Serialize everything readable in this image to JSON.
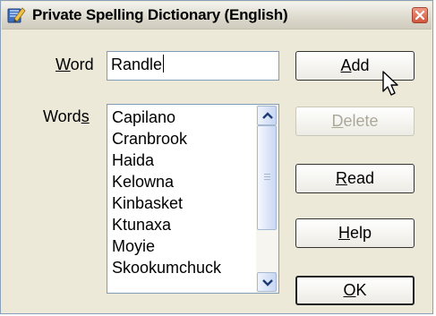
{
  "window": {
    "title": "Private Spelling Dictionary (English)"
  },
  "word_field": {
    "label_mnemonic": "W",
    "label_rest": "ord",
    "value": "Randle"
  },
  "words_list": {
    "label_prefix": "Word",
    "label_mnemonic": "s",
    "items": [
      "Capilano",
      "Cranbrook",
      "Haida",
      "Kelowna",
      "Kinbasket",
      "Ktunaxa",
      "Moyie",
      "Skookumchuck"
    ]
  },
  "buttons": {
    "add": {
      "mnemonic": "A",
      "rest": "dd"
    },
    "delete": {
      "mnemonic": "D",
      "rest": "elete"
    },
    "read": {
      "mnemonic": "R",
      "rest": "ead"
    },
    "help": {
      "mnemonic": "H",
      "rest": "elp"
    },
    "ok": {
      "mnemonic": "O",
      "rest": "K"
    }
  },
  "icons": {
    "app": "dictionary-icon",
    "close": "close-icon",
    "scroll_up": "chevron-up-icon",
    "scroll_down": "chevron-down-icon",
    "cursor": "mouse-pointer-icon"
  },
  "colors": {
    "dialog_bg": "#ece9d8",
    "close_button": "#d2553d",
    "disabled_text": "#aca899",
    "field_border": "#7f9db9"
  }
}
